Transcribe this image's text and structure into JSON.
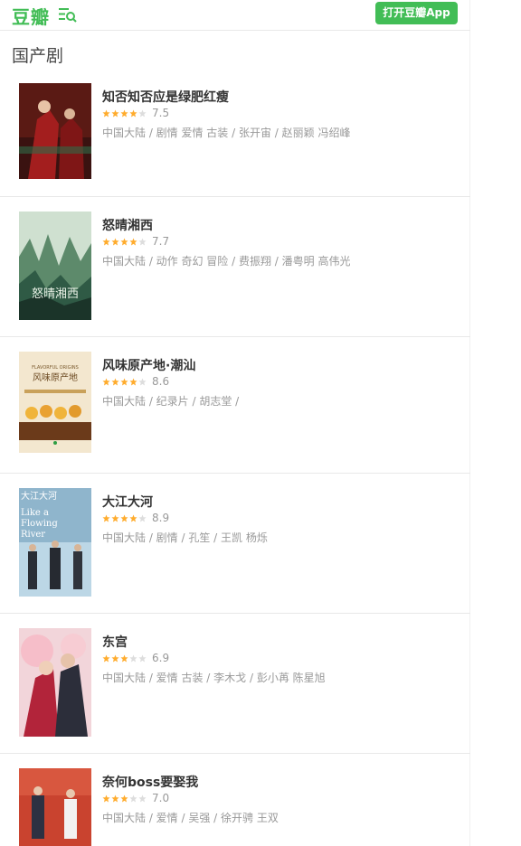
{
  "header": {
    "logo": "豆瓣",
    "open_app": "打开豆瓣App"
  },
  "section": {
    "title": "国产剧"
  },
  "items": [
    {
      "title": "知否知否应是绿肥红瘦",
      "rating": "7.5",
      "stars_full": 4,
      "meta": "中国大陆 / 剧情 爱情 古装 / 张开宙 / 赵丽颖 冯绍峰"
    },
    {
      "title": "怒晴湘西",
      "rating": "7.7",
      "stars_full": 4,
      "meta": "中国大陆 / 动作 奇幻 冒险 / 费振翔 / 潘粤明 高伟光"
    },
    {
      "title": "风味原产地·潮汕",
      "rating": "8.6",
      "stars_full": 4,
      "meta": "中国大陆 / 纪录片 / 胡志堂 /"
    },
    {
      "title": "大江大河",
      "rating": "8.9",
      "stars_full": 4,
      "meta": "中国大陆 / 剧情 / 孔笙 / 王凯 杨烁"
    },
    {
      "title": "东宫",
      "rating": "6.9",
      "stars_full": 3,
      "meta": "中国大陆 / 爱情 古装 / 李木戈 / 彭小苒 陈星旭"
    },
    {
      "title": "奈何boss要娶我",
      "rating": "7.0",
      "stars_full": 3,
      "meta": "中国大陆 / 爱情 / 吴强 / 徐开骋 王双"
    }
  ],
  "posters": {
    "poster_1": {
      "text1": "",
      "text2": ""
    },
    "poster_3": {
      "text1": "FLAVORFUL ORIGINS",
      "text2": "风味原产地"
    },
    "poster_4": {
      "text1": "大江大河",
      "text2": "Like a Flowing River"
    }
  },
  "colors": {
    "brand_green": "#42bd56",
    "star_on": "#ffac2d",
    "star_off": "#dddddd",
    "text_muted": "#999999",
    "title_text": "#333333"
  }
}
